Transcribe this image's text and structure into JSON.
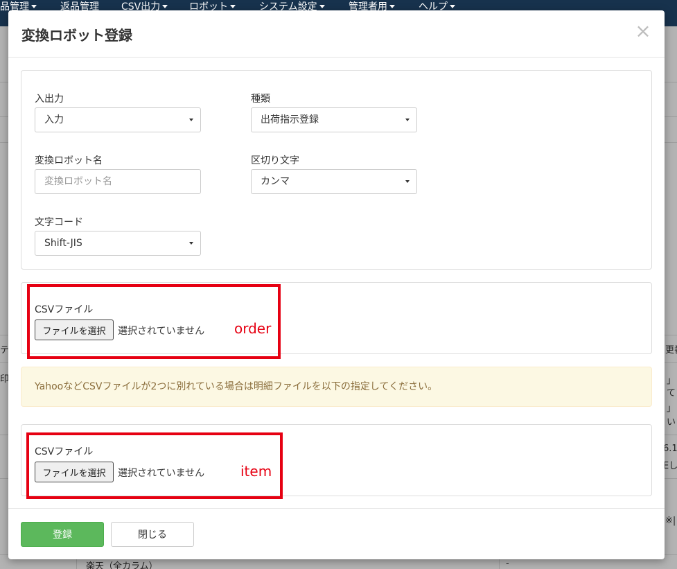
{
  "navbar": {
    "items": [
      {
        "label": "品管理"
      },
      {
        "label": "返品管理"
      },
      {
        "label": "CSV出力"
      },
      {
        "label": "ロボット"
      },
      {
        "label": "システム設定"
      },
      {
        "label": "管理者用"
      },
      {
        "label": "ヘルプ"
      }
    ]
  },
  "background": {
    "fragments": [
      "テ",
      "印",
      "更番",
      "」 (",
      "て",
      "」 る",
      "い",
      "6.1",
      "Eし",
      "※|",
      "楽天（全カラム）",
      "-"
    ]
  },
  "modal": {
    "title": "変換ロボット登録",
    "close_symbol": "×",
    "form": {
      "io": {
        "label": "入出力",
        "value": "入力"
      },
      "type": {
        "label": "種類",
        "value": "出荷指示登録"
      },
      "robot_name": {
        "label": "変換ロボット名",
        "value": "",
        "placeholder": "変換ロボット名"
      },
      "delimiter": {
        "label": "区切り文字",
        "value": "カンマ"
      },
      "encoding": {
        "label": "文字コード",
        "value": "Shift-JIS"
      }
    },
    "csv_order": {
      "label": "CSVファイル",
      "button_label": "ファイルを選択",
      "status": "選択されていません",
      "annotation": "order"
    },
    "alert_text": "YahooなどCSVファイルが2つに別れている場合は明細ファイルを以下の指定してください。",
    "csv_item": {
      "label": "CSVファイル",
      "button_label": "ファイルを選択",
      "status": "選択されていません",
      "annotation": "item"
    },
    "footer": {
      "register_label": "登録",
      "close_label": "閉じる"
    }
  },
  "colors": {
    "navbar": "#17324d",
    "primary": "#5cb85c",
    "alert_bg": "#fcf8e3",
    "alert_text": "#8a6d3b",
    "annotation_red": "#e60012"
  }
}
